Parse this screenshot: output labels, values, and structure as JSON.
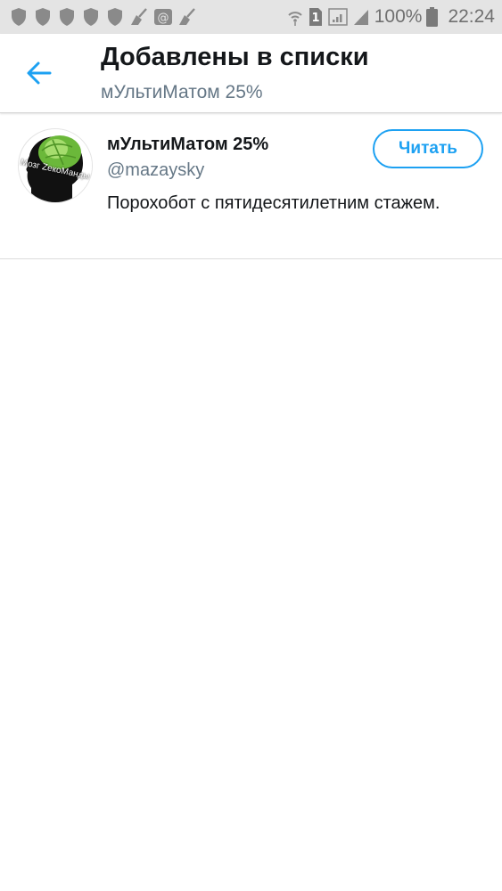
{
  "status_bar": {
    "notification_icons": [
      "shield-icon",
      "shield-icon",
      "shield-icon",
      "shield-icon",
      "shield-icon",
      "broom-icon",
      "at-sign-icon",
      "broom-icon"
    ],
    "sim_label": "1",
    "battery_percent": "100%",
    "time": "22:24"
  },
  "header": {
    "title": "Добавлены в списки",
    "subtitle": "мУльтиМатом 25%"
  },
  "user": {
    "name": "мУльтиМатом 25%",
    "handle": "@mazaysky",
    "bio": "Порохобот с пятидесятилетним стажем.",
    "avatar_text": "Мозг ZекоМанды",
    "follow_label": "Читать"
  },
  "colors": {
    "accent": "#1da1f2",
    "text_primary": "#14171a",
    "text_secondary": "#657786",
    "status_bar_bg": "#e4e4e4"
  }
}
